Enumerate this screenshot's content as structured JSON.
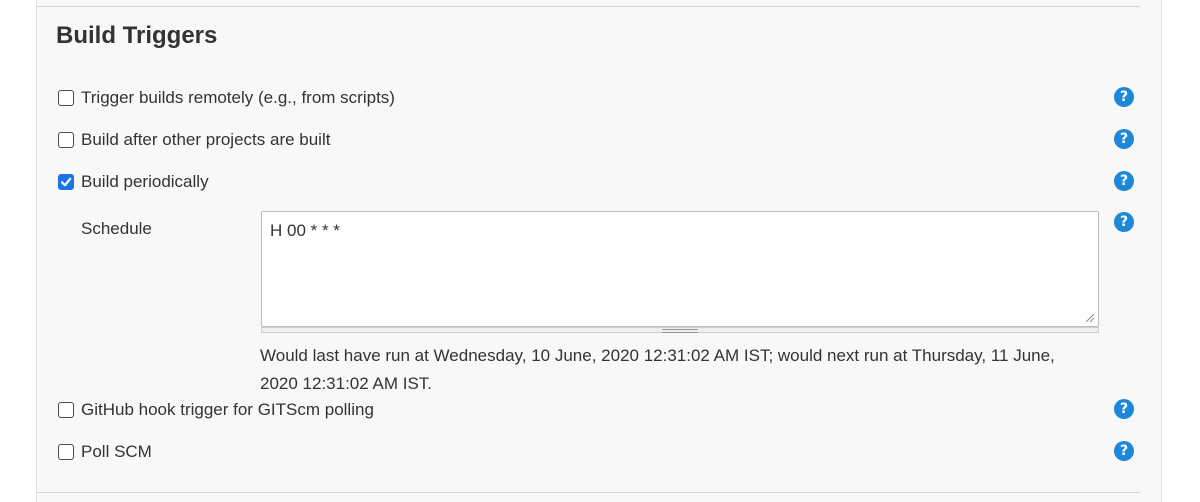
{
  "section": {
    "title": "Build Triggers"
  },
  "triggers": [
    {
      "label": "Trigger builds remotely (e.g., from scripts)",
      "checked": false
    },
    {
      "label": "Build after other projects are built",
      "checked": false
    },
    {
      "label": "Build periodically",
      "checked": true
    },
    {
      "label": "GitHub hook trigger for GITScm polling",
      "checked": false
    },
    {
      "label": "Poll SCM",
      "checked": false
    }
  ],
  "schedule": {
    "label": "Schedule",
    "value": "H 00 * * *",
    "info": "Would last have run at Wednesday, 10 June, 2020 12:31:02 AM IST; would next run at Thursday, 11 June, 2020 12:31:02 AM IST."
  },
  "help_icon": {
    "glyph": "?",
    "color": "#1e88d8"
  },
  "colors": {
    "accent": "#1a73e8"
  }
}
